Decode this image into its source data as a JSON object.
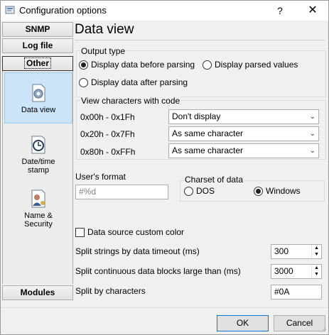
{
  "window": {
    "title": "Configuration options",
    "help_label": "?",
    "close_label": "✕"
  },
  "sidebar": {
    "snmp_label": "SNMP",
    "logfile_label": "Log file",
    "other_label": "Other",
    "modules_label": "Modules",
    "items": [
      {
        "label": "Data view",
        "icon": "gear-document-icon"
      },
      {
        "label": "Date/time\nstamp",
        "icon": "clock-icon"
      },
      {
        "label": "Name &\nSecurity",
        "icon": "user-document-icon"
      }
    ]
  },
  "page": {
    "title": "Data view",
    "output_type": {
      "label": "Output type",
      "before_parsing": "Display data before parsing",
      "parsed_values": "Display parsed values",
      "after_parsing": "Display data after parsing",
      "selected": "before_parsing"
    },
    "view_chars": {
      "label": "View characters with code",
      "rows": [
        {
          "range": "0x00h - 0x1Fh",
          "value": "Don't display"
        },
        {
          "range": "0x20h - 0x7Fh",
          "value": "As same character"
        },
        {
          "range": "0x80h - 0xFFh",
          "value": "As same character"
        }
      ]
    },
    "users_format": {
      "label": "User's format",
      "placeholder": "#%d"
    },
    "charset": {
      "label": "Charset of data",
      "dos": "DOS",
      "windows": "Windows",
      "selected": "windows"
    },
    "custom_color_label": "Data source custom color",
    "split_timeout": {
      "label": "Split strings by data timeout (ms)",
      "value": "300"
    },
    "split_blocks": {
      "label": "Split continuous data blocks large than (ms)",
      "value": "3000"
    },
    "split_chars": {
      "label": "Split by characters",
      "value": "#0A"
    }
  },
  "footer": {
    "ok_label": "OK",
    "cancel_label": "Cancel"
  }
}
